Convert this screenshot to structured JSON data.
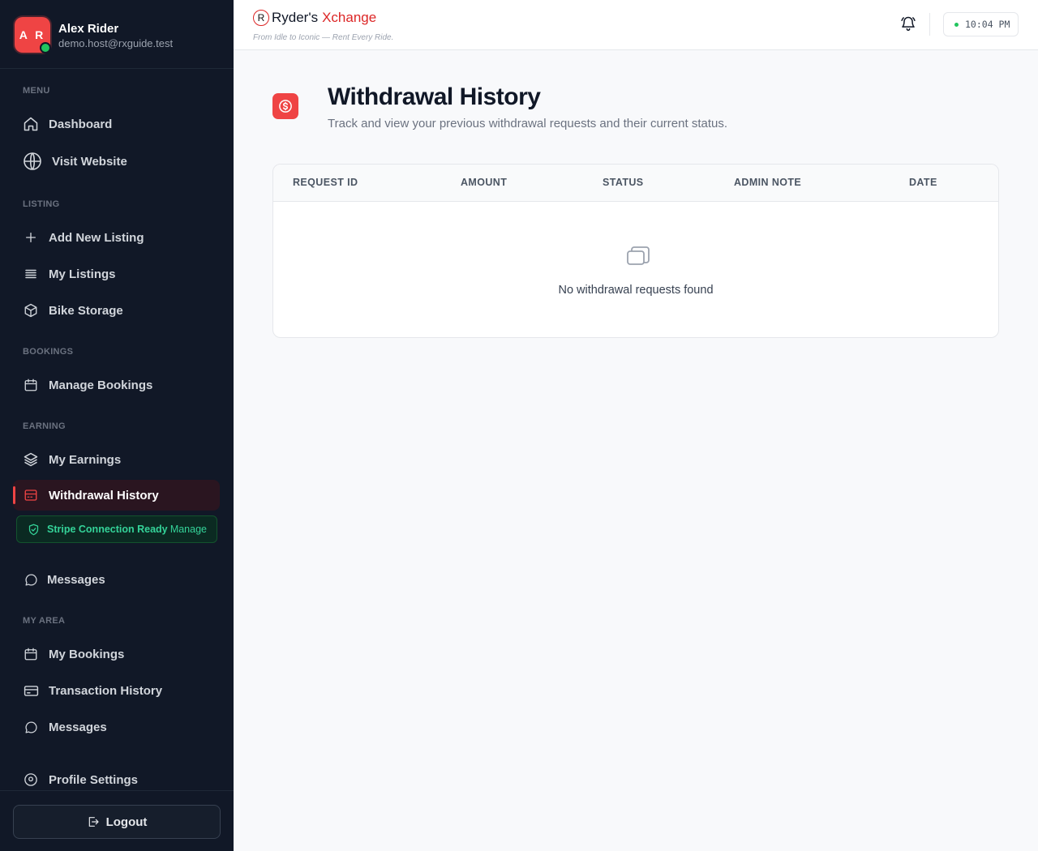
{
  "user": {
    "initials": "A R",
    "name": "Alex Rider",
    "email": "demo.host@rxguide.test"
  },
  "sidebar": {
    "sections": {
      "menu": "MENU",
      "listing": "LISTING",
      "bookings": "BOOKINGS",
      "earning": "EARNING",
      "my_area": "MY AREA"
    },
    "items": {
      "dashboard": "Dashboard",
      "visit_website": "Visit Website",
      "add_listing": "Add New Listing",
      "my_listings": "My Listings",
      "bike_storage": "Bike Storage",
      "manage_bookings": "Manage Bookings",
      "my_earnings": "My Earnings",
      "withdrawal_history": "Withdrawal History",
      "messages_host": "Messages",
      "my_bookings": "My Bookings",
      "transaction_history": "Transaction History",
      "messages_user": "Messages",
      "profile_settings": "Profile Settings"
    },
    "stripe": {
      "status": "Stripe Connection Ready",
      "manage": "Manage"
    },
    "logout": "Logout"
  },
  "header": {
    "logo_part1": "Ryder's",
    "logo_part2": "Xchange",
    "logo_mark": "R",
    "tagline": "From Idle to Iconic — Rent Every Ride.",
    "time": "10:04 PM"
  },
  "main": {
    "title": "Withdrawal History",
    "subtitle": "Track and view your previous withdrawal requests and their current status.",
    "columns": [
      "REQUEST ID",
      "AMOUNT",
      "STATUS",
      "ADMIN NOTE",
      "DATE"
    ],
    "empty_message": "No withdrawal requests found"
  },
  "colors": {
    "accent": "#ef4444",
    "sidebar_bg": "#111827",
    "success": "#34d399"
  }
}
